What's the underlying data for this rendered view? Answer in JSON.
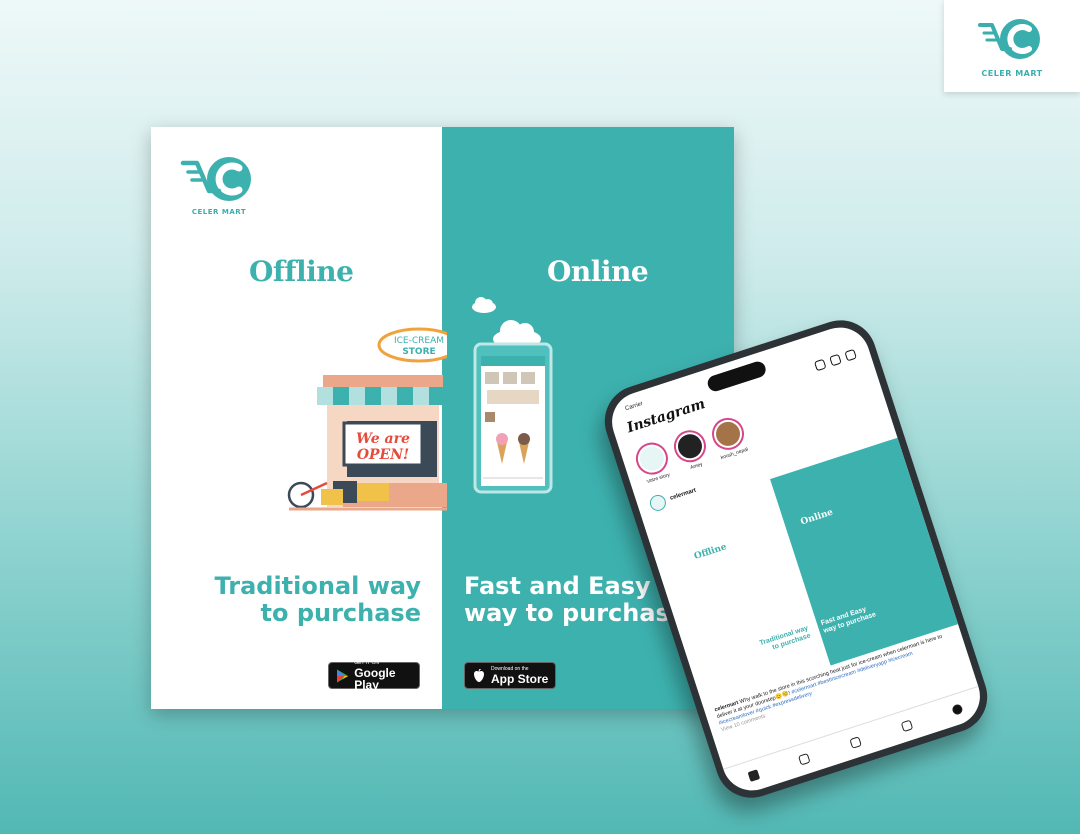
{
  "brand": {
    "name": "CELER MART",
    "accent": "#3db1ae",
    "logo_letter": "C"
  },
  "poster": {
    "offline": {
      "heading": "Offline",
      "tagline_line1": "Traditional way",
      "tagline_line2": "to purchase",
      "store_sign_line1": "ICE-CREAM",
      "store_sign_line2": "STORE",
      "open_sign_line1": "We are",
      "open_sign_line2": "OPEN!",
      "badge": {
        "small": "GET IT ON",
        "big": "Google Play",
        "icon": "google-play-icon"
      }
    },
    "online": {
      "heading": "Online",
      "tagline_line1": "Fast and Easy",
      "tagline_line2": "way to purchase",
      "badge": {
        "small": "Download on the",
        "big": "App Store",
        "icon": "apple-icon"
      }
    }
  },
  "phone": {
    "carrier": "Carrier",
    "app_title": "Instagram",
    "stories": [
      {
        "name": "Votre story",
        "color": "#e6f6f5"
      },
      {
        "name": "Amey",
        "color": "#222222"
      },
      {
        "name": "koush_nepal",
        "color": "#a47448"
      }
    ],
    "post_user": "celermart",
    "post_left_heading": "Offline",
    "post_right_heading": "Online",
    "post_left_tagline_1": "Traditional way",
    "post_left_tagline_2": "to purchase",
    "post_right_tagline_1": "Fast and Easy",
    "post_right_tagline_2": "way to purchase",
    "caption_user": "celermart",
    "caption_text": "Why walk to the store in this scorching heat just for ice-cream when celermart is here to deliver it at your doorstep😊😊!",
    "caption_tags": "#celermart #bestinicecream #deliveryapp #icecream #icecreamlover #quick #expressdelivery",
    "caption_meta": "View 10 comments"
  }
}
